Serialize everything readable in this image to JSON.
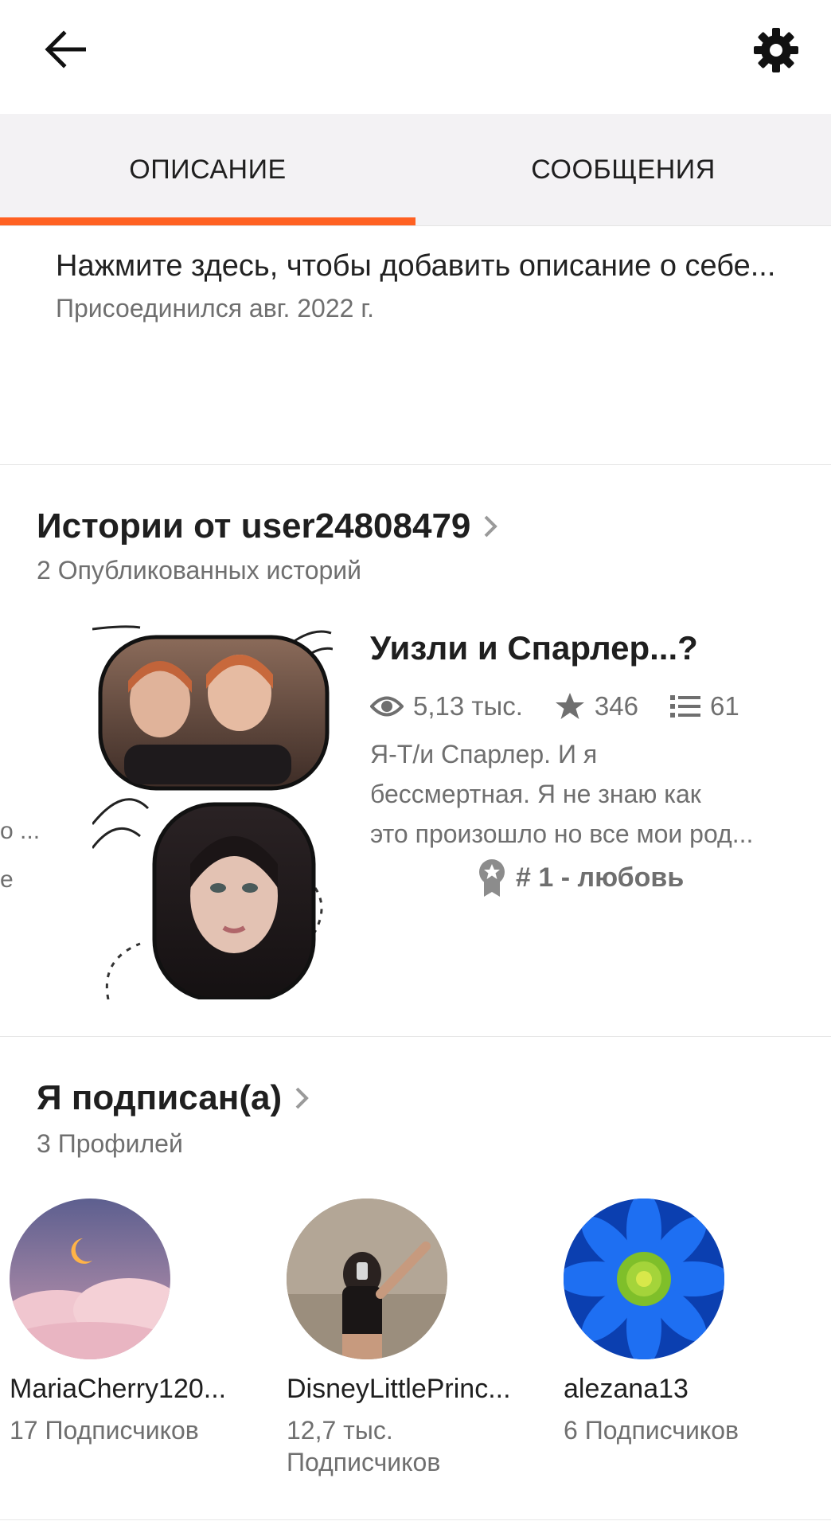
{
  "header": {
    "back_icon": "arrow-left-icon",
    "settings_icon": "gear-icon"
  },
  "tabs": [
    {
      "label": "ОПИСАНИЕ",
      "active": true
    },
    {
      "label": "СООБЩЕНИЯ",
      "active": false
    }
  ],
  "colors": {
    "accent": "#ff6122",
    "text": "#1f1f1f",
    "muted": "#6f6f6f",
    "tab_bg": "#f3f2f4"
  },
  "about": {
    "placeholder": "Нажмите здесь, чтобы добавить описание о себе...",
    "joined": "Присоединился авг. 2022 г."
  },
  "stories": {
    "title": "Истории от user24808479",
    "count": "2 Опубликованных историй",
    "peek_lines": [
      "о ...",
      "е"
    ],
    "featured": {
      "title": "Уизли и Спарлер...?",
      "views": "5,13 тыс.",
      "votes": "346",
      "parts": "61",
      "description_lines": [
        "Я-Т/и Спарлер. И я",
        "бессмертная. Я не знаю как",
        "это произошло но все мои род..."
      ],
      "rank": "# 1 - любовь"
    }
  },
  "following": {
    "title": "Я подписан(а)",
    "count": "3 Профилей",
    "profiles": [
      {
        "name": "MariaCherry120...",
        "followers": "17 Подписчиков"
      },
      {
        "name": "DisneyLittlePrinc...",
        "followers": "12,7 тыс. Подписчиков"
      },
      {
        "name": "alezana13",
        "followers": "6 Подписчиков"
      }
    ]
  }
}
